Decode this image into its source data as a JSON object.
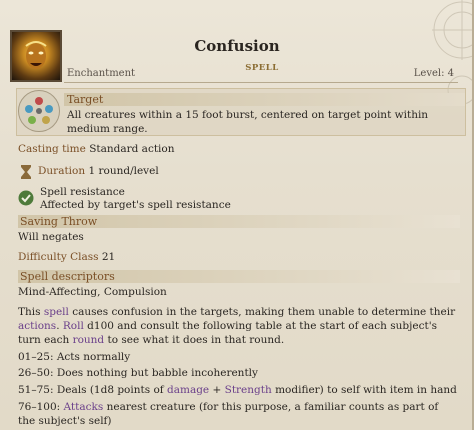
{
  "header": {
    "title": "Confusion",
    "school": "Enchantment",
    "tag": "SPELL",
    "level": "Level: 4"
  },
  "target": {
    "label": "Target",
    "text": "All creatures within a 15 foot burst, centered on target point within medium range."
  },
  "casting_time": {
    "label": "Casting time",
    "value": "Standard action"
  },
  "duration": {
    "label": "Duration",
    "value": "1 round/level"
  },
  "spell_resistance": {
    "label": "Spell resistance",
    "value": "Affected by target's spell resistance"
  },
  "saving_throw": {
    "label": "Saving Throw",
    "value": "Will negates"
  },
  "difficulty_class": {
    "label": "Difficulty Class",
    "value": "21"
  },
  "descriptors": {
    "label": "Spell descriptors",
    "value": "Mind-Affecting, Compulsion"
  },
  "description": {
    "t1": "This ",
    "link_spell": "spell",
    "t2": " causes confusion in the targets, making them unable to determine their ",
    "link_actions": "actions",
    "t3": ". ",
    "link_roll": "Roll",
    "t4": " d100 and consult the following table at the start of each subject's turn each ",
    "link_round": "round",
    "t5": " to see what it does in that round."
  },
  "table": {
    "r1": "01–25: Acts normally",
    "r2": "26–50: Does nothing but babble incoherently",
    "r3_a": "51–75: Deals (1d8 points of ",
    "r3_damage": "damage",
    "r3_b": " + ",
    "r3_strength": "Strength",
    "r3_c": " modifier) to self with item in hand",
    "r4_a": "76–100: ",
    "r4_attacks": "Attacks",
    "r4_b": " nearest creature (for this purpose, a familiar counts as part of the subject's self)"
  },
  "colors": {
    "label": "#7a4f26",
    "link": "#6a3f8a",
    "tag": "#8b6d33"
  }
}
